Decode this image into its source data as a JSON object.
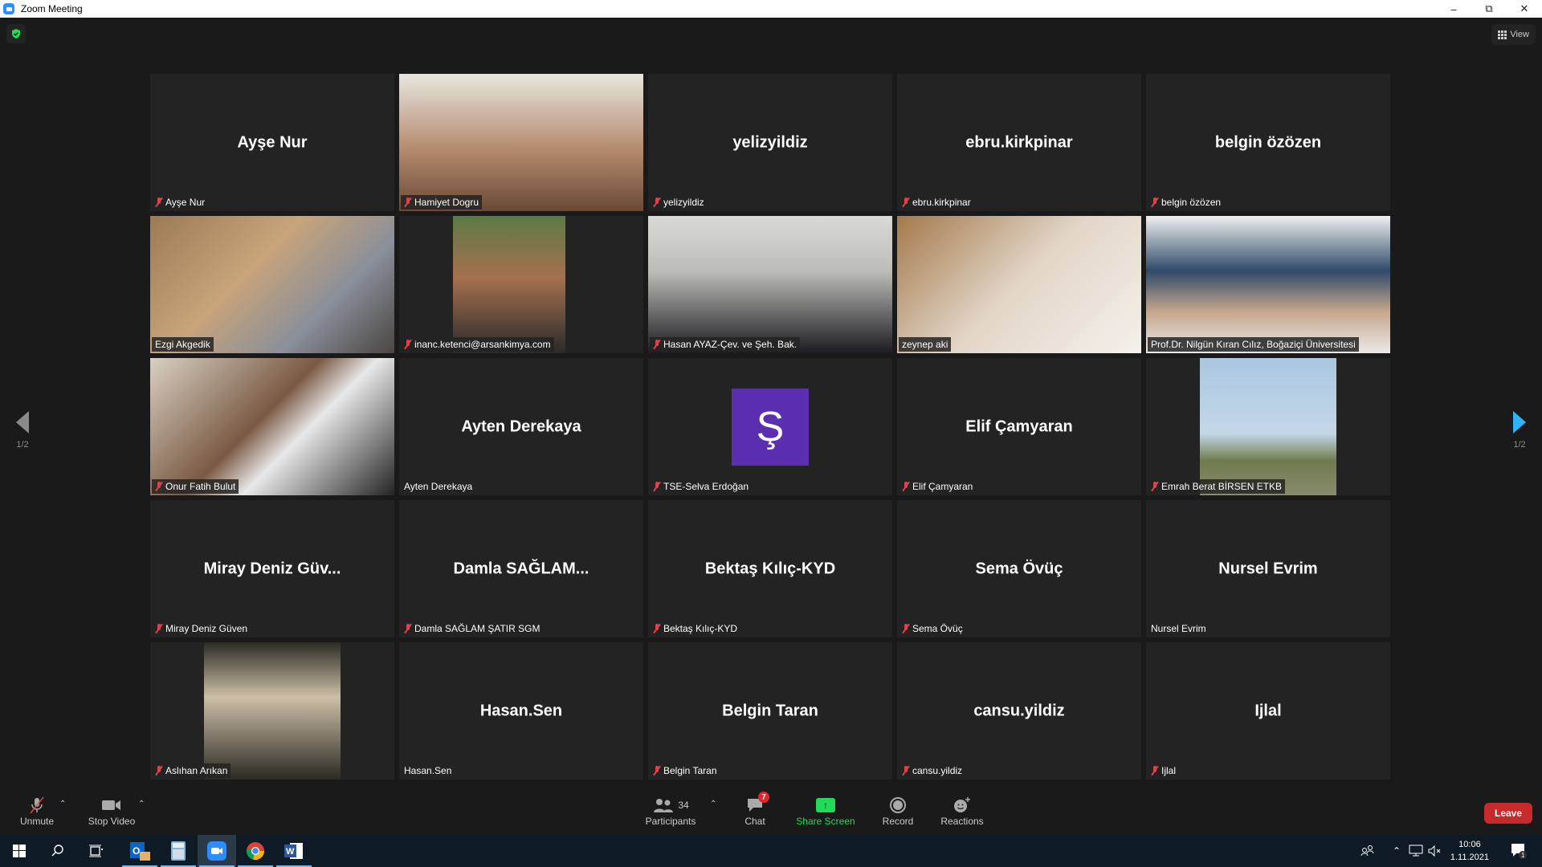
{
  "window": {
    "title": "Zoom Meeting",
    "controls": [
      "minimize",
      "restore",
      "close"
    ]
  },
  "top_bar": {
    "security_icon": "shield-check-icon",
    "view_label": "View"
  },
  "navigation": {
    "prev_page": "1/2",
    "next_page": "1/2"
  },
  "participants_grid": [
    {
      "display": "Ayşe Nur",
      "label": "Ayşe Nur",
      "muted": true,
      "video": false
    },
    {
      "display": "",
      "label": "Hamiyet Dogru",
      "muted": true,
      "video": true
    },
    {
      "display": "yelizyildiz",
      "label": "yelizyildiz",
      "muted": true,
      "video": false
    },
    {
      "display": "ebru.kirkpinar",
      "label": "ebru.kirkpinar",
      "muted": true,
      "video": false
    },
    {
      "display": "belgin özözen",
      "label": "belgin özözen",
      "muted": true,
      "video": false
    },
    {
      "display": "",
      "label": "Ezgi Akgedik",
      "muted": false,
      "video": true,
      "active_speaker": true
    },
    {
      "display": "",
      "label": "inanc.ketenci@arsankimya.com",
      "muted": true,
      "video": true
    },
    {
      "display": "",
      "label": "Hasan AYAZ-Çev. ve Şeh. Bak.",
      "muted": true,
      "video": true
    },
    {
      "display": "",
      "label": "zeynep aki",
      "muted": false,
      "video": true
    },
    {
      "display": "",
      "label": "Prof.Dr. Nilgün Kıran Cılız, Boğaziçi Üniversitesi",
      "muted": false,
      "video": true
    },
    {
      "display": "",
      "label": "Onur Fatih Bulut",
      "muted": true,
      "video": true
    },
    {
      "display": "Ayten Derekaya",
      "label": "Ayten Derekaya",
      "muted": false,
      "video": false
    },
    {
      "display": "",
      "label": "TSE-Selva Erdoğan",
      "muted": true,
      "video": false,
      "avatar_letter": "Ş"
    },
    {
      "display": "Elif Çamyaran",
      "label": "Elif Çamyaran",
      "muted": true,
      "video": false
    },
    {
      "display": "",
      "label": "Emrah Berat BİRSEN ETKB",
      "muted": true,
      "video": true
    },
    {
      "display": "Miray  Deniz Güv...",
      "label": "Miray Deniz Güven",
      "muted": true,
      "video": false
    },
    {
      "display": "Damla  SAĞLAM...",
      "label": "Damla SAĞLAM ŞATIR SGM",
      "muted": true,
      "video": false
    },
    {
      "display": "Bektaş Kılıç-KYD",
      "label": "Bektaş Kılıç-KYD",
      "muted": true,
      "video": false
    },
    {
      "display": "Sema Övüç",
      "label": "Sema Övüç",
      "muted": true,
      "video": false
    },
    {
      "display": "Nursel Evrim",
      "label": "Nursel Evrim",
      "muted": false,
      "video": false
    },
    {
      "display": "",
      "label": "Aslıhan Arıkan",
      "muted": true,
      "video": true
    },
    {
      "display": "Hasan.Sen",
      "label": "Hasan.Sen",
      "muted": false,
      "video": false
    },
    {
      "display": "Belgin Taran",
      "label": "Belgin Taran",
      "muted": true,
      "video": false
    },
    {
      "display": "cansu.yildiz",
      "label": "cansu.yildiz",
      "muted": true,
      "video": false
    },
    {
      "display": "Ijlal",
      "label": "Ijlal",
      "muted": true,
      "video": false
    }
  ],
  "toolbar": {
    "unmute": "Unmute",
    "stop_video": "Stop Video",
    "participants": "Participants",
    "participants_count": "34",
    "chat": "Chat",
    "chat_badge": "7",
    "share_screen": "Share Screen",
    "record": "Record",
    "reactions": "Reactions",
    "leave": "Leave"
  },
  "colors": {
    "share_green": "#23d959",
    "leave_red": "#c62a2a",
    "active_speaker": "#c5e05a",
    "next_arrow": "#2eb3f5"
  },
  "taskbar": {
    "apps": [
      "windows-start",
      "search",
      "task-view",
      "outlook",
      "calculator",
      "zoom",
      "chrome",
      "word"
    ],
    "time": "10:06",
    "date": "1.11.2021",
    "notification_count": "1"
  }
}
